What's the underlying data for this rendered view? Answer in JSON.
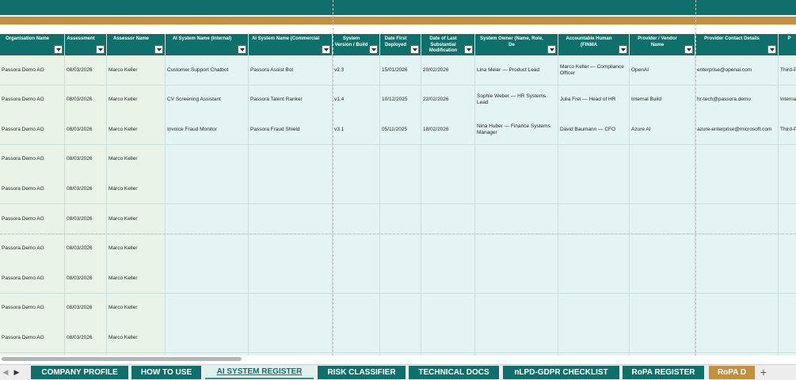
{
  "sheet": {
    "columns": [
      {
        "label": "Organisation Name",
        "color": "green"
      },
      {
        "label": "Assessment",
        "color": "green"
      },
      {
        "label": "Assessor Name",
        "color": "green"
      },
      {
        "label": "AI System Name (Internal)",
        "color": "teal"
      },
      {
        "label": "AI System Name (Commercial",
        "color": "teal"
      },
      {
        "label": "System Version / Build",
        "color": "teal"
      },
      {
        "label": "Date First Deployed",
        "color": "teal"
      },
      {
        "label": "Date of Last Substantial Modification",
        "color": "teal"
      },
      {
        "label": "System Owner (Name, Role, De",
        "color": "teal"
      },
      {
        "label": "Accountable Human (FINMA",
        "color": "teal"
      },
      {
        "label": "Provider / Vendor Name",
        "color": "teal"
      },
      {
        "label": "Provider Contact Details",
        "color": "teal"
      },
      {
        "label": "P",
        "color": "teal"
      }
    ],
    "rows": [
      [
        "Passora Demo AG",
        "08/03/2026",
        "Marco Keller",
        "Customer Support Chatbot",
        "Passora Assist Bot",
        "v2.3",
        "15/01/2026",
        "20/02/2026",
        "Lina Meier — Product Lead",
        "Marco Keller — Compliance Officer",
        "OpenAI",
        "enterprise@openai.com",
        "Third-P"
      ],
      [
        "Passora Demo AG",
        "08/03/2026",
        "Marco Keller",
        "CV Screening Assistant",
        "Passora Talent Ranker",
        "v1.4",
        "10/12/2025",
        "22/02/2026",
        "Sophie Weber — HR Systems Lead",
        "Julia Frei — Head of HR",
        "Internal Build",
        "hr-tech@passora.demo",
        "Interna"
      ],
      [
        "Passora Demo AG",
        "08/03/2026",
        "Marco Keller",
        "Invoice Fraud Monitor",
        "Passora Fraud Shield",
        "v3.1",
        "05/11/2025",
        "18/02/2026",
        "Nina Huber — Finance Systems Manager",
        "David Baumann — CFO",
        "Azure AI",
        "azure-enterprise@microsoft.com",
        "Third-P"
      ],
      [
        "Passora Demo AG",
        "08/03/2026",
        "Marco Keller",
        "",
        "",
        "",
        "",
        "",
        "",
        "",
        "",
        "",
        ""
      ],
      [
        "Passora Demo AG",
        "08/03/2026",
        "Marco Keller",
        "",
        "",
        "",
        "",
        "",
        "",
        "",
        "",
        "",
        ""
      ],
      [
        "Passora Demo AG",
        "08/03/2026",
        "Marco Keller",
        "",
        "",
        "",
        "",
        "",
        "",
        "",
        "",
        "",
        ""
      ],
      [
        "Passora Demo AG",
        "08/03/2026",
        "Marco Keller",
        "",
        "",
        "",
        "",
        "",
        "",
        "",
        "",
        "",
        ""
      ],
      [
        "Passora Demo AG",
        "08/03/2026",
        "Marco Keller",
        "",
        "",
        "",
        "",
        "",
        "",
        "",
        "",
        "",
        ""
      ],
      [
        "Passora Demo AG",
        "08/03/2026",
        "Marco Keller",
        "",
        "",
        "",
        "",
        "",
        "",
        "",
        "",
        "",
        ""
      ],
      [
        "Passora Demo AG",
        "08/03/2026",
        "Marco Keller",
        "",
        "",
        "",
        "",
        "",
        "",
        "",
        "",
        "",
        ""
      ],
      [
        "",
        "",
        "",
        "",
        "",
        "",
        "",
        "",
        "",
        "",
        "",
        "",
        ""
      ]
    ]
  },
  "tabs": [
    {
      "label": "COMPANY PROFILE",
      "state": "normal"
    },
    {
      "label": "HOW TO USE",
      "state": "normal"
    },
    {
      "label": "AI SYSTEM REGISTER",
      "state": "active"
    },
    {
      "label": "RISK CLASSIFIER",
      "state": "normal"
    },
    {
      "label": "TECHNICAL DOCS",
      "state": "normal"
    },
    {
      "label": "nLPD-GDPR CHECKLIST",
      "state": "normal"
    },
    {
      "label": "RoPA REGISTER",
      "state": "normal"
    },
    {
      "label": "RoPA D",
      "state": "gold"
    }
  ],
  "tab_add_symbol": "+",
  "nav": {
    "prev_symbol": "◀",
    "next_symbol": "▶"
  },
  "colors": {
    "header_teal": "#0f6f6a",
    "accent_gold": "#c3913e",
    "cell_green": "#eaf4e6",
    "cell_teal": "#e4f3f3"
  }
}
